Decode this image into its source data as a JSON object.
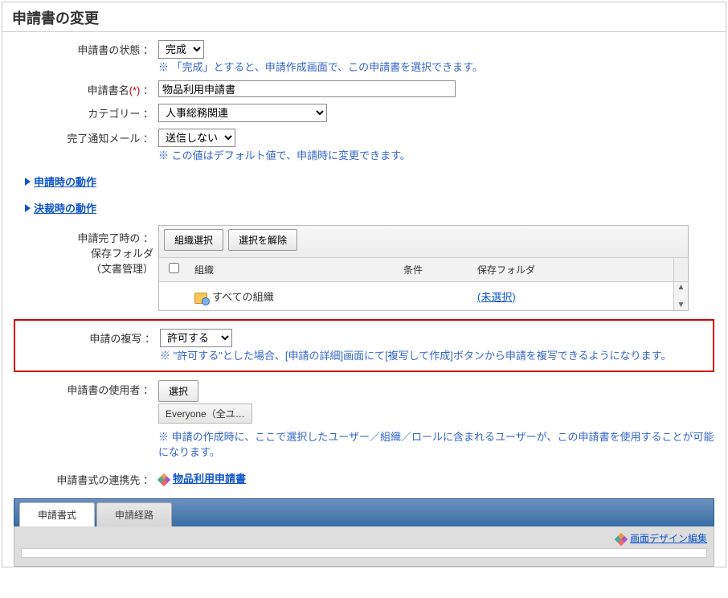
{
  "title": "申請書の変更",
  "labels": {
    "status": "申請書の状態 ：",
    "name": "申請書名",
    "required": "(*)",
    "colon": " ：",
    "category": "カテゴリー ：",
    "notifyMail": "完了通知メール ：",
    "folderLabel1": "申請完了時の ：",
    "folderLabel2": "保存フォルダ",
    "folderLabel3": "（文書管理）",
    "copy": "申請の複写 ：",
    "users": "申請書の使用者 ：",
    "formLink": "申請書式の連携先 ："
  },
  "fields": {
    "statusValue": "完成",
    "statusNote": "※ 「完成」とすると、申請作成画面で、この申請書を選択できます。",
    "nameValue": "物品利用申請書",
    "categoryValue": "人事総務関連",
    "notifyValue": "送信しない",
    "notifyNote": "※ この値はデフォルト値で、申請時に変更できます。",
    "copyValue": "許可する",
    "copyNote": "※ \"許可する\"とした場合、[申請の詳細]画面にて[複写して作成]ボタンから申請を複写できるようになります。",
    "usersChip": "Everyone（全ユ…",
    "usersNote": "※ 申請の作成時に、ここで選択したユーザー／組織／ロールに含まれるユーザーが、この申請書を使用することが可能になります。",
    "formLinkText": "物品利用申請書"
  },
  "collapse": {
    "apply": "申請時の動作",
    "decide": "決裁時の動作"
  },
  "folderGrid": {
    "btnSelectOrg": "組織選択",
    "btnClear": "選択を解除",
    "colOrg": "組織",
    "colCond": "条件",
    "colFolder": "保存フォルダ",
    "rowOrg": "すべての組織",
    "rowFolder": "(未選択)"
  },
  "buttons": {
    "selectUser": "選択"
  },
  "tabs": {
    "format": "申請書式",
    "route": "申請経路",
    "designLink": "画面デザイン編集"
  }
}
